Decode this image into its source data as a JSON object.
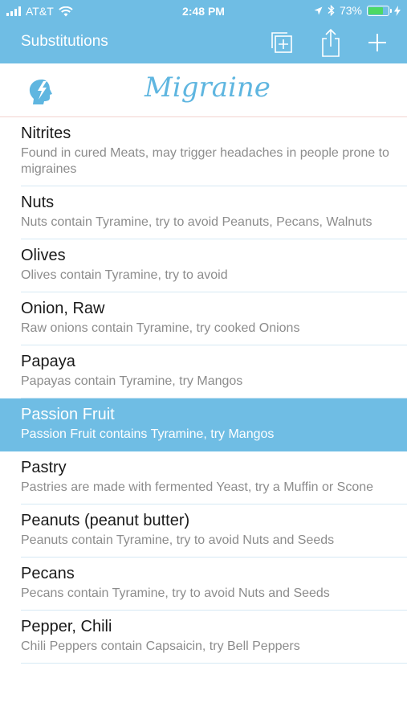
{
  "status_bar": {
    "carrier": "AT&T",
    "time": "2:48 PM",
    "battery_percent": "73%",
    "battery_level": 0.73
  },
  "nav": {
    "back_label": "Substitutions",
    "icons": [
      "add-copy-icon",
      "share-icon",
      "plus-icon"
    ]
  },
  "header": {
    "title": "Migraine",
    "logo_icon": "head-lightning-icon"
  },
  "colors": {
    "accent": "#6fbde4",
    "title": "#5fb6e0",
    "battery": "#4cd964"
  },
  "items": [
    {
      "name": "Nitrites",
      "desc": "Found in cured Meats, may trigger headaches in people prone to migraines",
      "selected": false
    },
    {
      "name": "Nuts",
      "desc": "Nuts contain Tyramine, try to avoid Peanuts, Pecans, Walnuts",
      "selected": false
    },
    {
      "name": "Olives",
      "desc": "Olives contain Tyramine, try to avoid",
      "selected": false
    },
    {
      "name": "Onion, Raw",
      "desc": "Raw onions contain Tyramine, try cooked Onions",
      "selected": false
    },
    {
      "name": "Papaya",
      "desc": "Papayas contain Tyramine, try Mangos",
      "selected": false
    },
    {
      "name": "Passion Fruit",
      "desc": "Passion Fruit contains Tyramine, try Mangos",
      "selected": true
    },
    {
      "name": "Pastry",
      "desc": "Pastries are made with fermented Yeast, try a Muffin or Scone",
      "selected": false
    },
    {
      "name": "Peanuts (peanut butter)",
      "desc": "Peanuts contain Tyramine, try to avoid Nuts and Seeds",
      "selected": false
    },
    {
      "name": "Pecans",
      "desc": "Pecans contain Tyramine, try to avoid Nuts and Seeds",
      "selected": false
    },
    {
      "name": "Pepper, Chili",
      "desc": "Chili Peppers contain Capsaicin, try Bell Peppers",
      "selected": false
    }
  ]
}
